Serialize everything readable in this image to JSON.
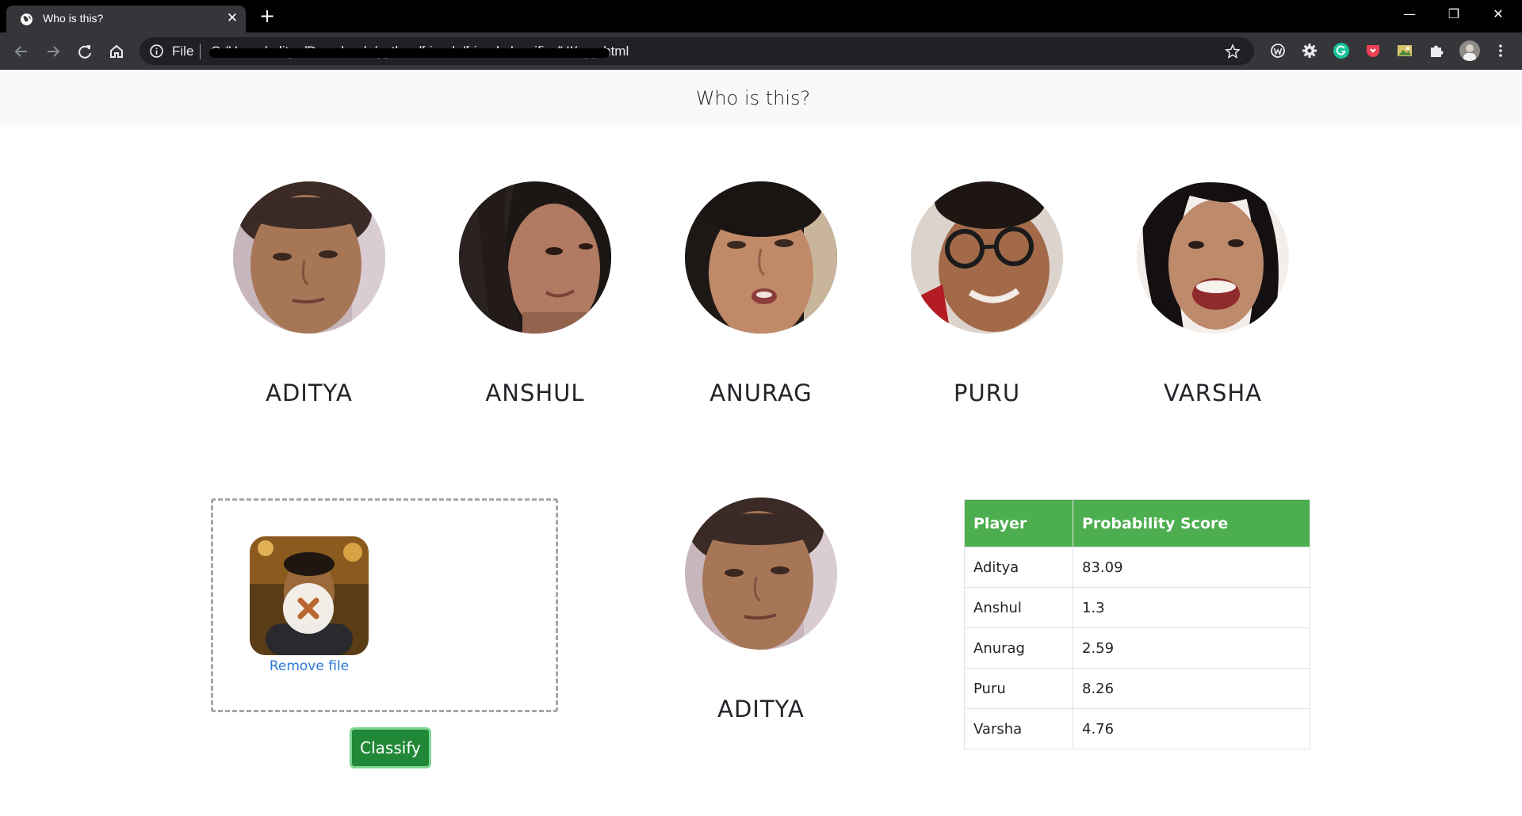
{
  "browser": {
    "tab_title": "Who is this?",
    "tab_close": "✕",
    "new_tab": "+",
    "window_controls": {
      "minimize": "—",
      "restore": "❐",
      "close": "✕"
    },
    "address": {
      "scheme_label": "File",
      "url": "C:/Users/aditya/Downloads/python/friends/friend-classifier/UI/app.html",
      "url_visible_suffix": "/app.html"
    },
    "icons": [
      "back-icon",
      "forward-icon",
      "reload-icon",
      "home-icon",
      "info-icon",
      "star-icon",
      "extension-w-icon",
      "extension-gear-icon",
      "grammarly-icon",
      "pocket-icon",
      "image-extension-icon",
      "puzzle-icon",
      "profile-avatar-icon",
      "kebab-menu-icon"
    ]
  },
  "page": {
    "header_title": "Who is this?",
    "people": [
      {
        "name": "ADITYA"
      },
      {
        "name": "ANSHUL"
      },
      {
        "name": "ANURAG"
      },
      {
        "name": "PURU"
      },
      {
        "name": "VARSHA"
      }
    ],
    "upload": {
      "remove_label": "Remove file",
      "classify_label": "Classify"
    },
    "result": {
      "name": "ADITYA"
    },
    "table": {
      "headers": [
        "Player",
        "Probability Score"
      ],
      "rows": [
        {
          "player": "Aditya",
          "score": "83.09"
        },
        {
          "player": "Anshul",
          "score": "1.3"
        },
        {
          "player": "Anurag",
          "score": "2.59"
        },
        {
          "player": "Puru",
          "score": "8.26"
        },
        {
          "player": "Varsha",
          "score": "4.76"
        }
      ]
    }
  },
  "colors": {
    "table_header": "#4cae4f",
    "classify_button": "#218838",
    "link": "#2a7ad8",
    "header_bg": "#f8f9fa"
  }
}
